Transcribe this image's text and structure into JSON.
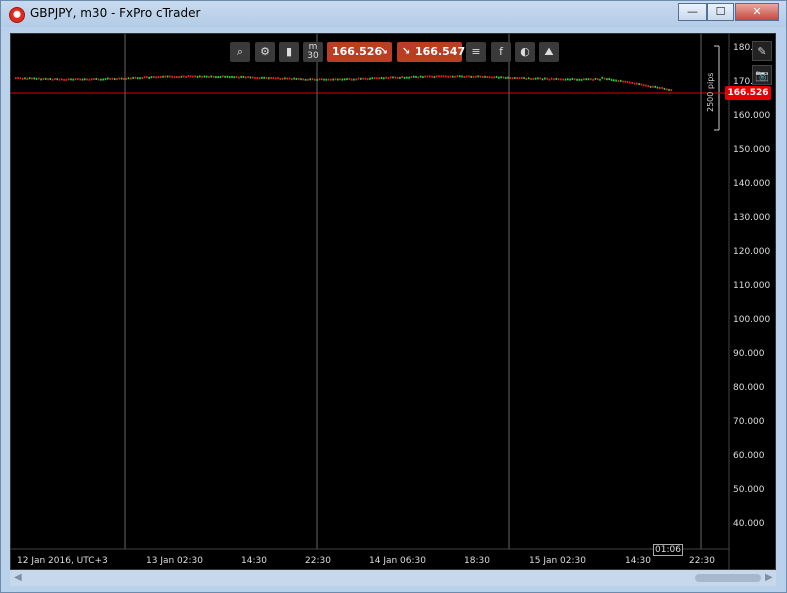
{
  "window": {
    "title": "GBPJPY, m30 - FxPro cTrader",
    "buttons": {
      "minimize": "—",
      "maximize": "☐",
      "close": "✕"
    }
  },
  "toolbar": {
    "zoom_icon": "⌕",
    "settings_icon": "⚙",
    "candle_icon": "▮",
    "timeframe_line1": "m",
    "timeframe_line2": "30",
    "sell_price": "166.526",
    "sell_arrow": "↘",
    "buy_price": "166.547",
    "buy_arrow": "↘",
    "list_icon": "≡",
    "facebook_icon": "f",
    "objects_icon": "◐",
    "indicators_icon": "⛰"
  },
  "side_buttons": {
    "edit_icon": "✎",
    "camera_icon": "📷"
  },
  "y_axis": {
    "ticks": [
      "180.",
      "170.",
      "160.000",
      "150.000",
      "140.000",
      "130.000",
      "120.000",
      "110.000",
      "100.000",
      "90.000",
      "80.000",
      "70.000",
      "60.000",
      "50.000",
      "40.000"
    ]
  },
  "x_axis": {
    "ticks": [
      "12 Jan 2016, UTC+3",
      "13 Jan 02:30",
      "14:30",
      "22:30",
      "14 Jan 06:30",
      "18:30",
      "15 Jan 02:30",
      "14:30",
      "22:30"
    ]
  },
  "current_price_label": "166.526",
  "pips_label": "2500 pips",
  "time_marker": "01:06",
  "colors": {
    "up": "#22d93a",
    "down": "#e82424",
    "price_line": "#e60000"
  }
}
